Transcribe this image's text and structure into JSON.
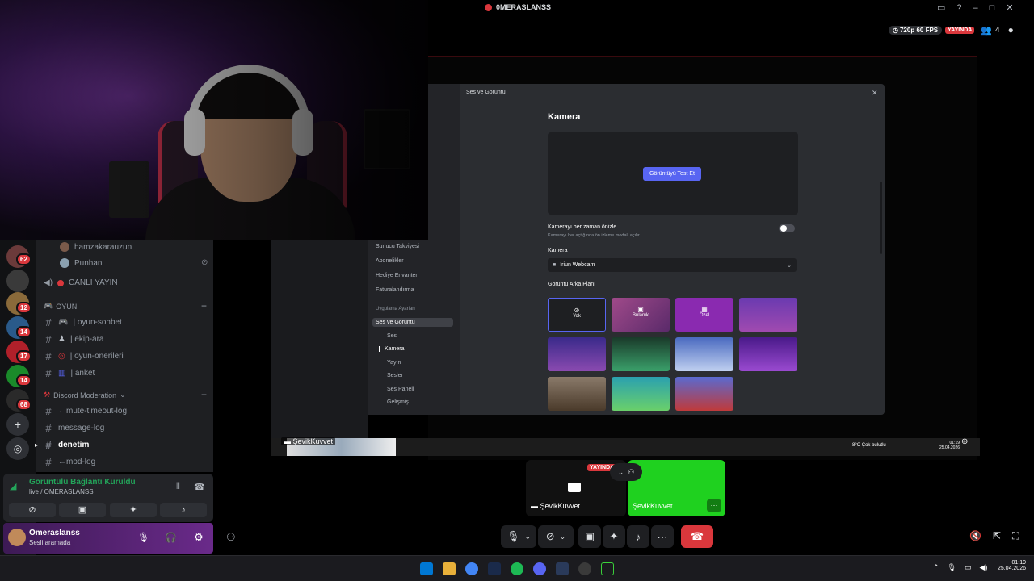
{
  "webcam": {},
  "servers": [
    {
      "badge": "62",
      "color": "#6b3a3a"
    },
    {
      "badge": "",
      "color": "#3a3a3a"
    },
    {
      "badge": "12",
      "color": "#8a6a3a"
    },
    {
      "badge": "14",
      "color": "#2a5a8a"
    },
    {
      "badge": "17",
      "color": "#b0202a"
    },
    {
      "badge": "14",
      "color": "#1a8a2a"
    },
    {
      "badge": "68",
      "color": "#2a2a2a"
    }
  ],
  "channels": {
    "members": [
      "hamzakarauzun",
      "Punhan"
    ],
    "live_label": "CANLI YAYIN",
    "category_oyun": "OYUN",
    "oyun_channels": [
      "| oyun-sohbet",
      "| ekip-ara",
      "| oyun-önerileri",
      "| anket"
    ],
    "category_mod": "Discord Moderation",
    "mod_channels": [
      "←mute-timeout-log",
      "message-log",
      "denetim",
      "←mod-log"
    ]
  },
  "voice": {
    "status": "Görüntülü Bağlantı Kuruldu",
    "location": "live / OMERASLANSS"
  },
  "user": {
    "name": "Omeraslanss",
    "status": "Sesli aramada"
  },
  "stream": {
    "title": "0MERASLANSS",
    "quality": "720p 60 FPS",
    "live_badge": "YAYINDA",
    "viewers": "4"
  },
  "settings": {
    "modal_title": "Ses ve Görüntü",
    "section_title": "Kamera",
    "test_button": "Görüntüyü Test Et",
    "preview_label": "Kamerayı her zaman önizle",
    "preview_desc": "Kamerayı her açtığında ön izleme modalı açılır",
    "camera_label": "Kamera",
    "camera_value": "Iriun Webcam",
    "bg_label": "Görüntü Arka Planı",
    "bg_none": "Yok",
    "bg_blur": "Bulanık",
    "bg_custom": "Özel",
    "side_items": [
      "Sunucu Takviyesi",
      "Abonelikler",
      "Hediye Envanteri",
      "Faturalandırma"
    ],
    "app_settings_header": "Uygulama Ayarları",
    "app_items": [
      "Ses ve Görüntü",
      "Ses",
      "Kamera",
      "Yayın",
      "Sesler",
      "Ses Paneli",
      "Gelişmiş"
    ]
  },
  "inner_taskbar": {
    "weather": "8°C  Çok bulutlu",
    "time": "01:19",
    "date": "25.04.2026"
  },
  "participants": [
    {
      "name": "ŞevikKuvvet",
      "badge": "YAYINDA"
    },
    {
      "name": "ŞevikKuvvet",
      "more": "···"
    }
  ],
  "overlay_name": "ŞevikKuvvet",
  "taskbar": {
    "time": "01:19",
    "date": "25.04.2026"
  },
  "colors": {
    "discord_blurple": "#5865f2",
    "live_red": "#da373c",
    "speaking_green": "#23a55a",
    "tile_green": "#1fd11f"
  }
}
